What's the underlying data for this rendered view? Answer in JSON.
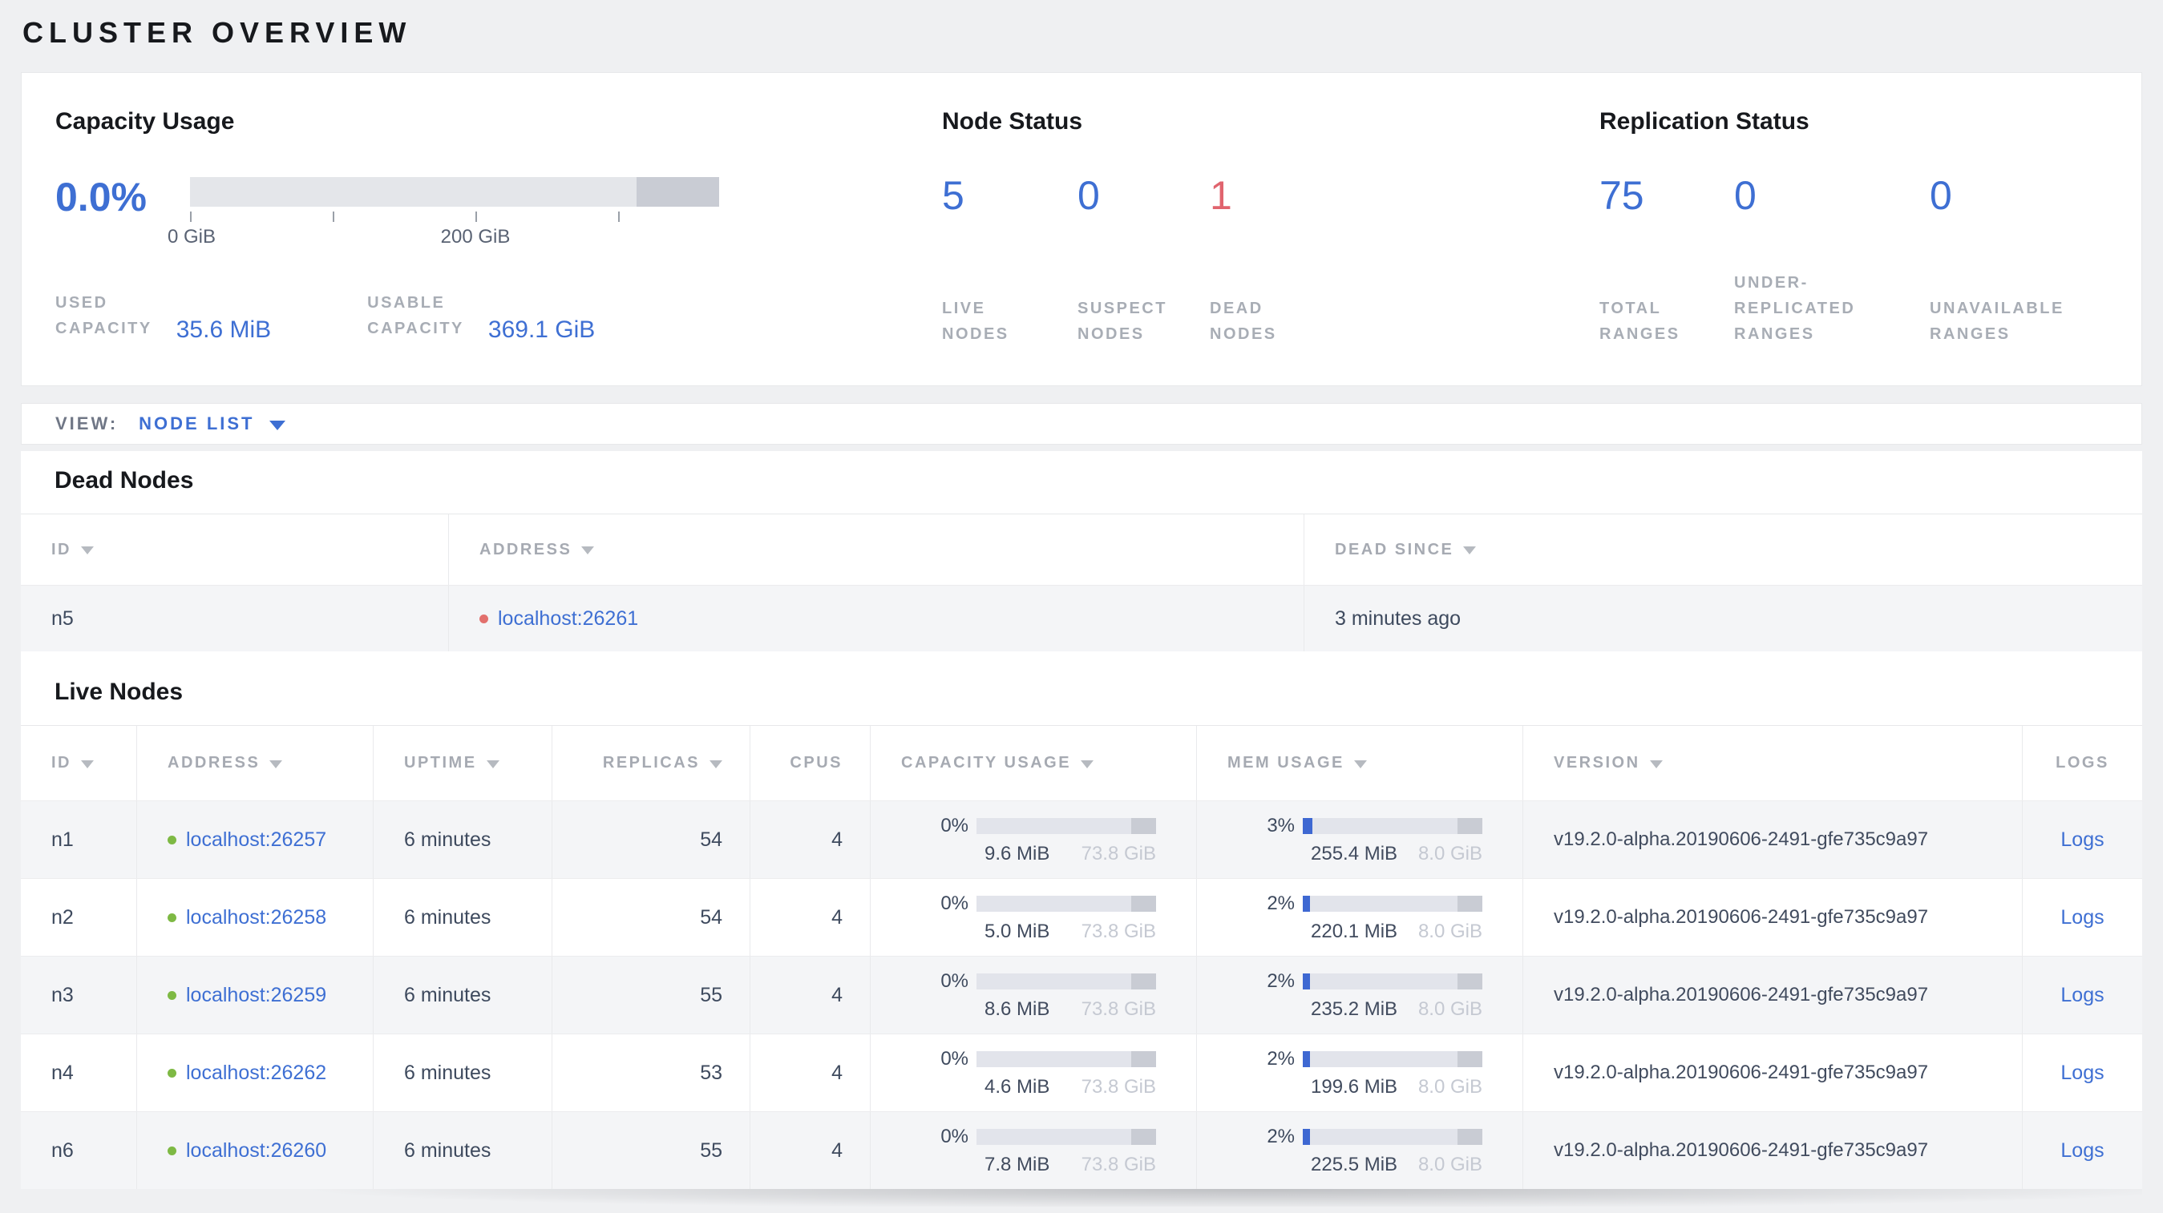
{
  "colors": {
    "accent_blue": "#3e6fd3",
    "alert_red": "#e0646e",
    "live_green": "#7eb944",
    "dead_red": "#e2706d"
  },
  "page_title": "CLUSTER OVERVIEW",
  "summary": {
    "capacity": {
      "title": "Capacity Usage",
      "percent": "0.0%",
      "tick_labels": [
        "0 GiB",
        "200 GiB"
      ],
      "stats": [
        {
          "label": "USED\nCAPACITY",
          "value": "35.6 MiB"
        },
        {
          "label": "USABLE\nCAPACITY",
          "value": "369.1 GiB"
        }
      ]
    },
    "node_status": {
      "title": "Node Status",
      "stats": [
        {
          "value": "5",
          "label": "LIVE\nNODES"
        },
        {
          "value": "0",
          "label": "SUSPECT\nNODES"
        },
        {
          "value": "1",
          "label": "DEAD\nNODES"
        }
      ]
    },
    "replication": {
      "title": "Replication Status",
      "stats": [
        {
          "value": "75",
          "label": "TOTAL\nRANGES"
        },
        {
          "value": "0",
          "label": "UNDER-\nREPLICATED\nRANGES"
        },
        {
          "value": "0",
          "label": "UNAVAILABLE\nRANGES"
        }
      ]
    }
  },
  "view_bar": {
    "label": "VIEW:",
    "selected": "NODE LIST"
  },
  "dead_nodes": {
    "title": "Dead Nodes",
    "columns": [
      {
        "label": "ID"
      },
      {
        "label": "ADDRESS"
      },
      {
        "label": "DEAD SINCE"
      }
    ],
    "rows": [
      {
        "id": "n5",
        "address": "localhost:26261",
        "dead_since": "3 minutes ago"
      }
    ]
  },
  "live_nodes": {
    "title": "Live Nodes",
    "columns": [
      {
        "label": "ID"
      },
      {
        "label": "ADDRESS"
      },
      {
        "label": "UPTIME"
      },
      {
        "label": "REPLICAS"
      },
      {
        "label": "CPUS"
      },
      {
        "label": "CAPACITY USAGE"
      },
      {
        "label": "MEM USAGE"
      },
      {
        "label": "VERSION"
      },
      {
        "label": "LOGS"
      }
    ],
    "logs_label": "Logs",
    "rows": [
      {
        "id": "n1",
        "address": "localhost:26257",
        "uptime": "6 minutes",
        "replicas": "54",
        "cpus": "4",
        "capacity": {
          "percent": "0%",
          "used": "9.6 MiB",
          "total": "73.8 GiB"
        },
        "memory": {
          "percent": "3%",
          "used": "255.4 MiB",
          "total": "8.0 GiB"
        },
        "version": "v19.2.0-alpha.20190606-2491-gfe735c9a97"
      },
      {
        "id": "n2",
        "address": "localhost:26258",
        "uptime": "6 minutes",
        "replicas": "54",
        "cpus": "4",
        "capacity": {
          "percent": "0%",
          "used": "5.0 MiB",
          "total": "73.8 GiB"
        },
        "memory": {
          "percent": "2%",
          "used": "220.1 MiB",
          "total": "8.0 GiB"
        },
        "version": "v19.2.0-alpha.20190606-2491-gfe735c9a97"
      },
      {
        "id": "n3",
        "address": "localhost:26259",
        "uptime": "6 minutes",
        "replicas": "55",
        "cpus": "4",
        "capacity": {
          "percent": "0%",
          "used": "8.6 MiB",
          "total": "73.8 GiB"
        },
        "memory": {
          "percent": "2%",
          "used": "235.2 MiB",
          "total": "8.0 GiB"
        },
        "version": "v19.2.0-alpha.20190606-2491-gfe735c9a97"
      },
      {
        "id": "n4",
        "address": "localhost:26262",
        "uptime": "6 minutes",
        "replicas": "53",
        "cpus": "4",
        "capacity": {
          "percent": "0%",
          "used": "4.6 MiB",
          "total": "73.8 GiB"
        },
        "memory": {
          "percent": "2%",
          "used": "199.6 MiB",
          "total": "8.0 GiB"
        },
        "version": "v19.2.0-alpha.20190606-2491-gfe735c9a97"
      },
      {
        "id": "n6",
        "address": "localhost:26260",
        "uptime": "6 minutes",
        "replicas": "55",
        "cpus": "4",
        "capacity": {
          "percent": "0%",
          "used": "7.8 MiB",
          "total": "73.8 GiB"
        },
        "memory": {
          "percent": "2%",
          "used": "225.5 MiB",
          "total": "8.0 GiB"
        },
        "version": "v19.2.0-alpha.20190606-2491-gfe735c9a97"
      }
    ]
  }
}
